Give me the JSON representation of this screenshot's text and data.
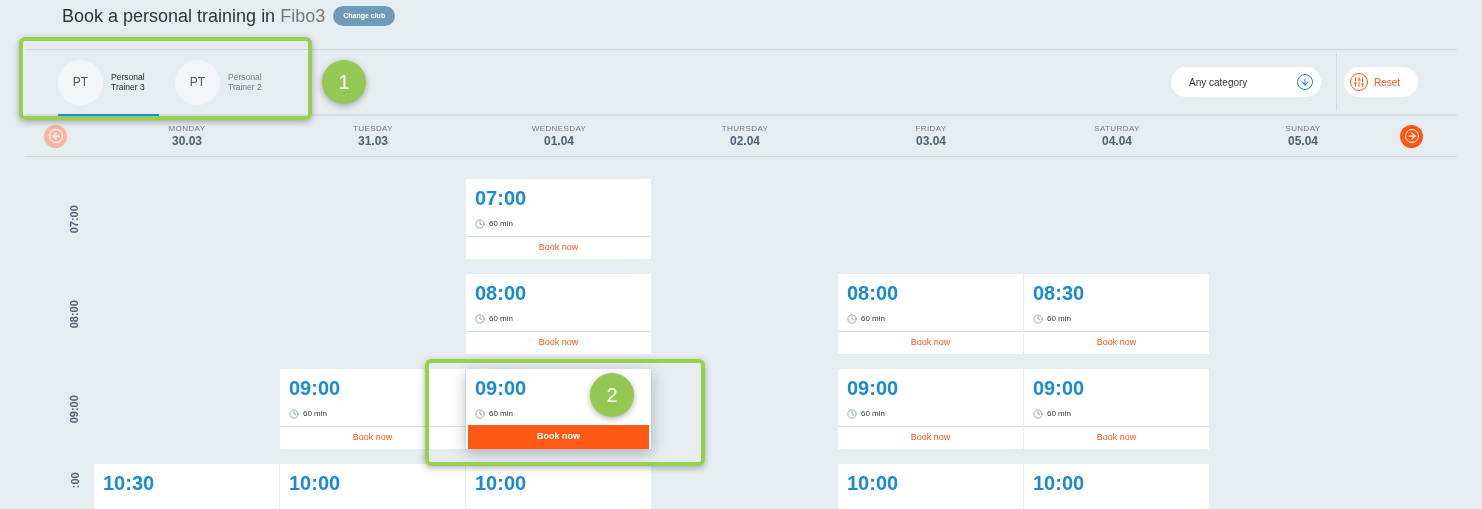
{
  "header": {
    "title": "Book a personal training in ",
    "club": "Fibo3",
    "change_button": "Change club"
  },
  "trainers": [
    {
      "initials": "PT",
      "name": "Personal Trainer 3",
      "selected": true
    },
    {
      "initials": "PT",
      "name": "Personal Trainer 2",
      "selected": false
    }
  ],
  "category_select": {
    "value": "Any category"
  },
  "reset_button": "Reset",
  "week_nav": {
    "prev": {
      "disabled": true
    },
    "next": {
      "disabled": false
    }
  },
  "days": [
    {
      "weekday": "MONDAY",
      "date": "30.03"
    },
    {
      "weekday": "TUESDAY",
      "date": "31.03"
    },
    {
      "weekday": "WEDNESDAY",
      "date": "01.04"
    },
    {
      "weekday": "THURSDAY",
      "date": "02.04"
    },
    {
      "weekday": "FRIDAY",
      "date": "03.04"
    },
    {
      "weekday": "SATURDAY",
      "date": "04.04"
    },
    {
      "weekday": "SUNDAY",
      "date": "05.04"
    }
  ],
  "rows": [
    {
      "label": "07:00",
      "slots": [
        {
          "kind": "empty"
        },
        {
          "kind": "empty"
        },
        {
          "kind": "slot",
          "time": "07:00",
          "duration": "60 min",
          "button": "Book now",
          "highlighted": false
        },
        {
          "kind": "empty"
        },
        {
          "kind": "empty"
        },
        {
          "kind": "empty"
        },
        {
          "kind": "empty"
        }
      ]
    },
    {
      "label": "08:00",
      "slots": [
        {
          "kind": "empty"
        },
        {
          "kind": "empty"
        },
        {
          "kind": "slot",
          "time": "08:00",
          "duration": "60 min",
          "button": "Book now",
          "highlighted": false
        },
        {
          "kind": "empty"
        },
        {
          "kind": "slot",
          "time": "08:00",
          "duration": "60 min",
          "button": "Book now",
          "highlighted": false
        },
        {
          "kind": "slot",
          "time": "08:30",
          "duration": "60 min",
          "button": "Book now",
          "highlighted": false
        },
        {
          "kind": "empty"
        }
      ]
    },
    {
      "label": "09:00",
      "slots": [
        {
          "kind": "empty"
        },
        {
          "kind": "slot",
          "time": "09:00",
          "duration": "60 min",
          "button": "Book now",
          "highlighted": false
        },
        {
          "kind": "slot",
          "time": "09:00",
          "duration": "60 min",
          "button": "Book now",
          "highlighted": true
        },
        {
          "kind": "empty"
        },
        {
          "kind": "slot",
          "time": "09:00",
          "duration": "60 min",
          "button": "Book now",
          "highlighted": false
        },
        {
          "kind": "slot",
          "time": "09:00",
          "duration": "60 min",
          "button": "Book now",
          "highlighted": false
        },
        {
          "kind": "empty"
        }
      ]
    },
    {
      "label": ":00",
      "slots": [
        {
          "kind": "slot",
          "time": "10:30",
          "highlighted": false
        },
        {
          "kind": "slot",
          "time": "10:00",
          "highlighted": false
        },
        {
          "kind": "slot",
          "time": "10:00",
          "highlighted": false
        },
        {
          "kind": "empty"
        },
        {
          "kind": "slot",
          "time": "10:00",
          "highlighted": false
        },
        {
          "kind": "slot",
          "time": "10:00",
          "highlighted": false
        },
        {
          "kind": "empty"
        }
      ]
    }
  ],
  "annotations": [
    {
      "label": "1"
    },
    {
      "label": "2"
    }
  ]
}
